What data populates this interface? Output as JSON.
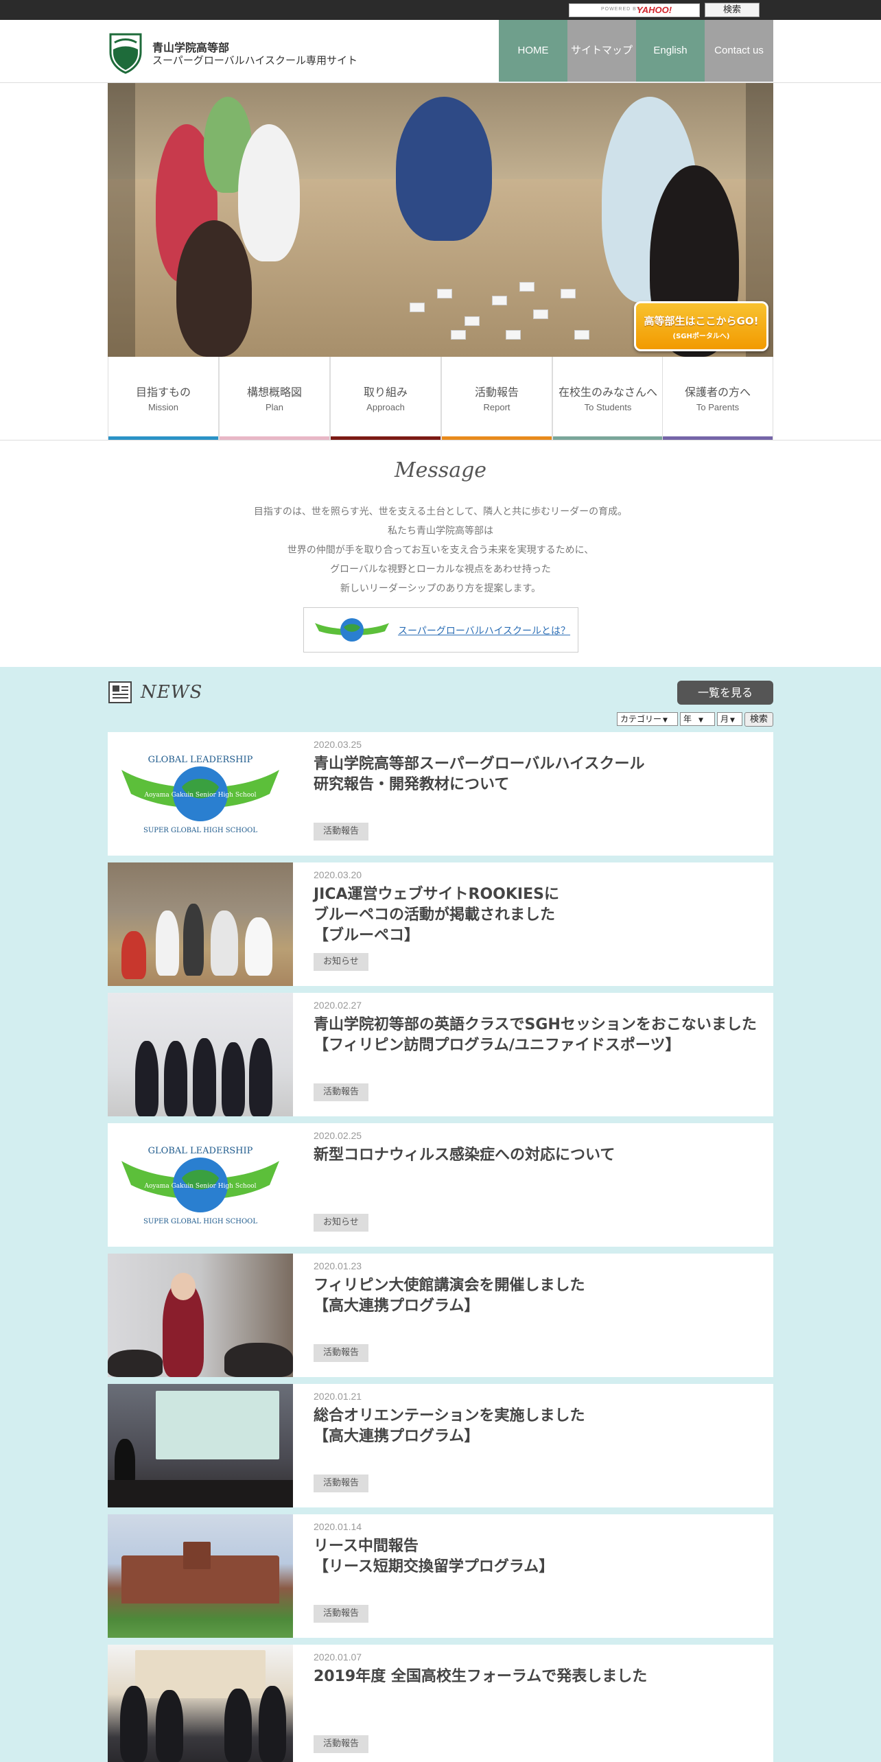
{
  "topbar": {
    "powered_by": "POWERED BY",
    "yahoo_logo": "YAHOO!",
    "search_button": "検索"
  },
  "header": {
    "school_name": "青山学院高等部",
    "site_subtitle": "スーパーグローバルハイスクール専用サイト",
    "nav": [
      {
        "label": "HOME"
      },
      {
        "label": "サイトマップ"
      },
      {
        "label": "English"
      },
      {
        "label": "Contact us"
      }
    ],
    "colors": {
      "nav_green": "#6f9f8c",
      "nav_gray": "#a2a2a2",
      "logo_green": "#1e6b3a"
    }
  },
  "hero": {
    "portal_button_line1": "高等部生はここからGO!",
    "portal_button_line2": "(SGHポータルへ)"
  },
  "categories": [
    {
      "jp": "目指すもの",
      "en": "Mission",
      "color": "#2b93c7"
    },
    {
      "jp": "構想概略図",
      "en": "Plan",
      "color": "#e8b7c6"
    },
    {
      "jp": "取り組み",
      "en": "Approach",
      "color": "#7c1a14"
    },
    {
      "jp": "活動報告",
      "en": "Report",
      "color": "#e88a1c"
    },
    {
      "jp": "在校生のみなさんへ",
      "en": "To Students",
      "color": "#7aa69a"
    },
    {
      "jp": "保護者の方へ",
      "en": "To Parents",
      "color": "#7565a8"
    }
  ],
  "message": {
    "title": "Message",
    "lines": [
      "目指すのは、世を照らす光、世を支える土台として、隣人と共に歩むリーダーの育成。",
      "私たち青山学院高等部は",
      "世界の仲間が手を取り合ってお互いを支え合う未来を実現するために、",
      "グローバルな視野とローカルな視点をあわせ持った",
      "新しいリーダーシップのあり方を提案します。"
    ],
    "sgh_link": "スーパーグローバルハイスクールとは？"
  },
  "news": {
    "title": "NEWS",
    "list_button": "一覧を見る",
    "filters": {
      "category": "カテゴリー",
      "year": "年",
      "month": "月",
      "search": "検索"
    },
    "items": [
      {
        "date": "2020.03.25",
        "title": "青山学院高等部スーパーグローバルハイスクール\n研究報告・開発教材について",
        "tag": "活動報告",
        "thumb": "logo"
      },
      {
        "date": "2020.03.20",
        "title": "JICA運営ウェブサイトROOKIESに\nブルーペコの活動が掲載されました\n【ブルーペコ】",
        "tag": "お知らせ",
        "thumb": "photo-a"
      },
      {
        "date": "2020.02.27",
        "title": "青山学院初等部の英語クラスでSGHセッションをおこないました\n【フィリピン訪問プログラム/ユニファイドスポーツ】",
        "tag": "活動報告",
        "thumb": "photo-b"
      },
      {
        "date": "2020.02.25",
        "title": "新型コロナウィルス感染症への対応について",
        "tag": "お知らせ",
        "thumb": "logo"
      },
      {
        "date": "2020.01.23",
        "title": "フィリピン大使館講演会を開催しました\n【高大連携プログラム】",
        "tag": "活動報告",
        "thumb": "photo-c"
      },
      {
        "date": "2020.01.21",
        "title": "総合オリエンテーションを実施しました\n【高大連携プログラム】",
        "tag": "活動報告",
        "thumb": "photo-d"
      },
      {
        "date": "2020.01.14",
        "title": "リース中間報告\n【リース短期交換留学プログラム】",
        "tag": "活動報告",
        "thumb": "photo-e"
      },
      {
        "date": "2020.01.07",
        "title": "2019年度 全国高校生フォーラムで発表しました",
        "tag": "活動報告",
        "thumb": "photo-f"
      }
    ],
    "logo_banner_text": "GLOBAL LEADERSHIP",
    "logo_ribbon_text": "Aoyama Gakuin Senior High School",
    "logo_bottom_text": "SUPER GLOBAL HIGH SCHOOL",
    "background": "#d3eef0"
  }
}
